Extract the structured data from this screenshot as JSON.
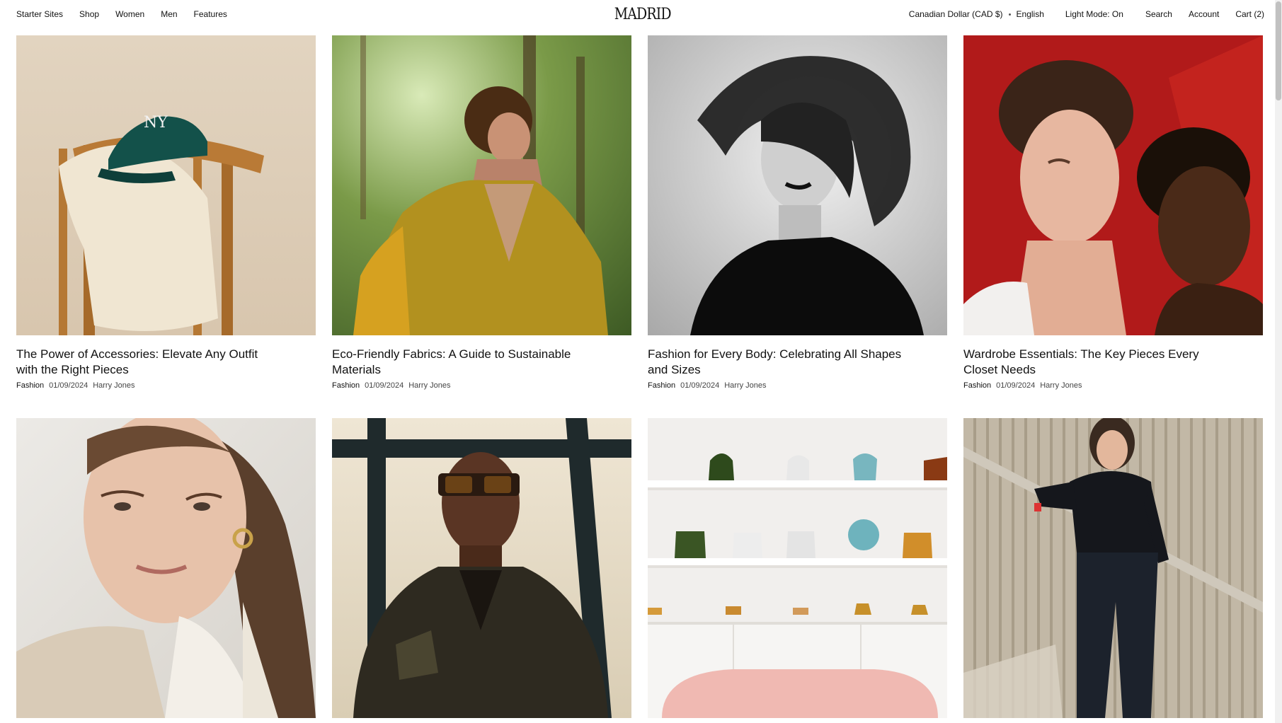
{
  "header": {
    "nav_left": [
      "Starter Sites",
      "Shop",
      "Women",
      "Men",
      "Features"
    ],
    "logo": "MADRID",
    "currency": "Canadian Dollar (CAD $)",
    "language": "English",
    "light_mode": "Light Mode: On",
    "search": "Search",
    "account": "Account",
    "cart": "Cart (2)"
  },
  "posts": [
    {
      "title": "The Power of Accessories: Elevate Any Outfit with the Right Pieces",
      "category": "Fashion",
      "date": "01/09/2024",
      "author": "Harry Jones",
      "image": "cap-on-chair-photo"
    },
    {
      "title": "Eco-Friendly Fabrics: A Guide to Sustainable Materials",
      "category": "Fashion",
      "date": "01/09/2024",
      "author": "Harry Jones",
      "image": "man-in-forest-photo"
    },
    {
      "title": "Fashion for Every Body: Celebrating All Shapes and Sizes",
      "category": "Fashion",
      "date": "01/09/2024",
      "author": "Harry Jones",
      "image": "black-white-hair-motion-photo"
    },
    {
      "title": "Wardrobe Essentials: The Key Pieces Every Closet Needs",
      "category": "Fashion",
      "date": "01/09/2024",
      "author": "Harry Jones",
      "image": "two-men-red-background-photo"
    },
    {
      "image": "woman-portrait-photo"
    },
    {
      "image": "man-leather-jacket-photo"
    },
    {
      "image": "bags-on-shelves-photo"
    },
    {
      "image": "woman-on-stairs-photo"
    }
  ]
}
